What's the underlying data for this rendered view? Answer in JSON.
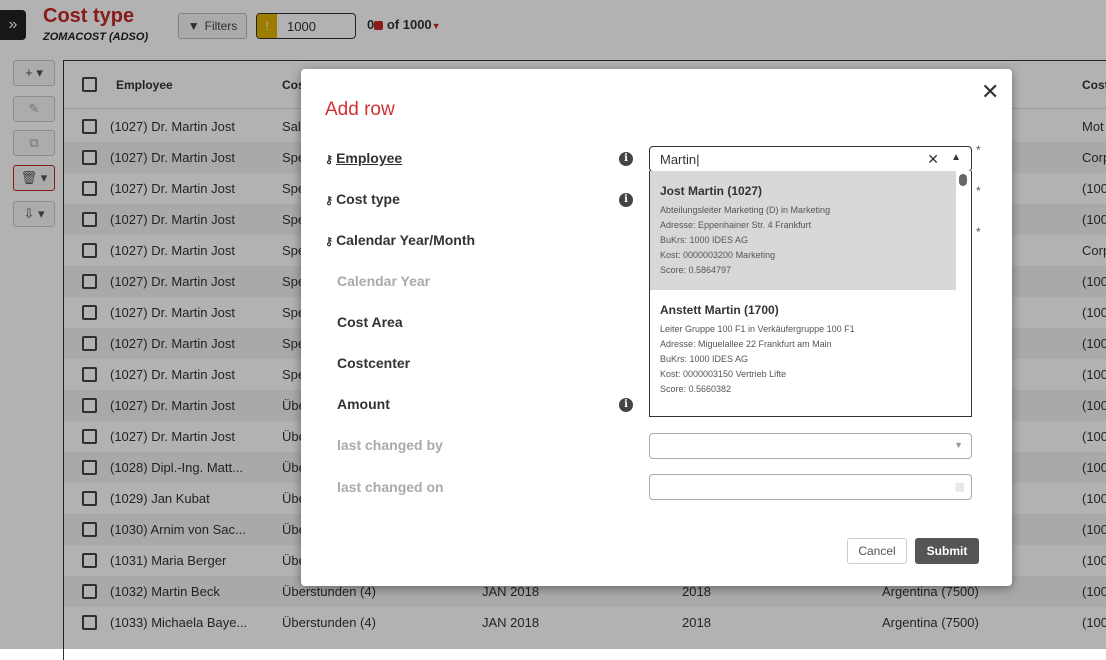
{
  "header": {
    "title": "Cost type",
    "subtitle": "ZOMACOST (ADSO)",
    "filters_label": "Filters",
    "limit_value": "1000",
    "count_selected": "0",
    "count_total": "of 1000"
  },
  "toolbar": {
    "add": "+ ▾",
    "edit": "✎",
    "copy": "⧉",
    "delete": "🗑 ▾",
    "export": "⇩ ▾"
  },
  "table": {
    "columns": [
      "Employee",
      "Cos",
      "Cost"
    ],
    "rows": [
      [
        "(1027) Dr. Martin Jost",
        "Sal",
        "Mot"
      ],
      [
        "(1027) Dr. Martin Jost",
        "Spe",
        "Corp"
      ],
      [
        "(1027) Dr. Martin Jost",
        "Spe",
        "(100"
      ],
      [
        "(1027) Dr. Martin Jost",
        "Spe",
        "(100"
      ],
      [
        "(1027) Dr. Martin Jost",
        "Spe",
        "Corp"
      ],
      [
        "(1027) Dr. Martin Jost",
        "Spe",
        "(100"
      ],
      [
        "(1027) Dr. Martin Jost",
        "Spe",
        "(100"
      ],
      [
        "(1027) Dr. Martin Jost",
        "Spe",
        "(100"
      ],
      [
        "(1027) Dr. Martin Jost",
        "Spe",
        "(100"
      ],
      [
        "(1027) Dr. Martin Jost",
        "Übe",
        "(100"
      ],
      [
        "(1027) Dr. Martin Jost",
        "Übe",
        "(100"
      ],
      [
        "(1028) Dipl.-Ing. Matt...",
        "Übe",
        "(100"
      ],
      [
        "(1029) Jan Kubat",
        "Übe",
        "(100"
      ],
      [
        "(1030) Arnim von Sac...",
        "Übe",
        "(100"
      ],
      [
        "(1031) Maria Berger",
        "Übe",
        "(100"
      ],
      [
        "(1032) Martin Beck",
        "Überstunden (4)",
        "(100",
        "JAN 2018",
        "2018",
        "Argentina (7500)"
      ],
      [
        "(1033) Michaela Baye...",
        "Überstunden (4)",
        "(100",
        "JAN 2018",
        "2018",
        "Argentina (7500)"
      ]
    ]
  },
  "modal": {
    "title": "Add row",
    "close": "✕",
    "fields": [
      {
        "label": "Employee",
        "required": true,
        "info": true
      },
      {
        "label": "Cost type",
        "required": true,
        "info": true
      },
      {
        "label": "Calendar Year/Month",
        "required": true,
        "info": false
      },
      {
        "label": "Calendar Year",
        "dim": true
      },
      {
        "label": "Cost Area"
      },
      {
        "label": "Costcenter"
      },
      {
        "label": "Amount",
        "info": true
      },
      {
        "label": "last changed by",
        "dim": true
      },
      {
        "label": "last changed on",
        "dim": true
      }
    ],
    "employee_value": "Martin",
    "options": [
      {
        "name": "Jost Martin (1027)",
        "lines": [
          "Abteilungsleiter Marketing (D) in Marketing",
          "Adresse: Eppenhainer Str. 4 Frankfurt",
          "BuKrs: 1000 IDES AG",
          "Kost: 0000003200 Marketing",
          "Score: 0.5864797"
        ]
      },
      {
        "name": "Anstett Martin (1700)",
        "lines": [
          "Leiter Gruppe 100 F1 in Verkäufergruppe 100 F1",
          "Adresse: Miguelallee 22 Frankfurt am Main",
          "BuKrs: 1000 IDES AG",
          "Kost: 0000003150 Vertrieb Lifte",
          "Score: 0.5660382"
        ]
      }
    ],
    "cancel": "Cancel",
    "submit": "Submit",
    "required_mark": "*",
    "info_glyph": "i"
  }
}
